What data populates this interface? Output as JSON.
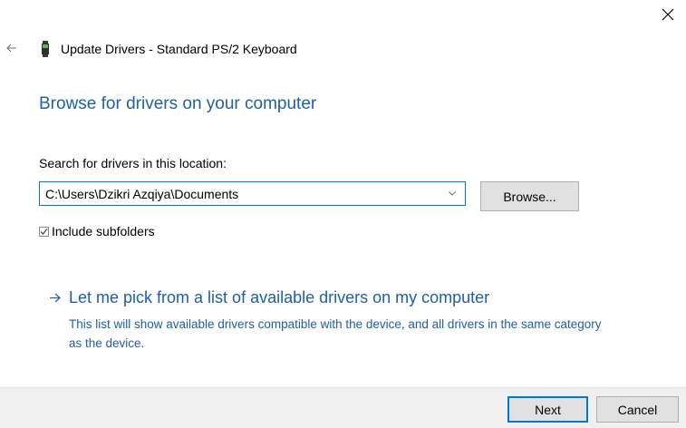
{
  "window": {
    "title": "Update Drivers - Standard PS/2 Keyboard",
    "title_icon": "keyboard-device-icon",
    "close_icon": "close-icon",
    "back_icon": "back-arrow-icon"
  },
  "main": {
    "heading": "Browse for drivers on your computer",
    "search_label": "Search for drivers in this location:",
    "path_value": "C:\\Users\\Dzikri Azqiya\\Documents",
    "browse_label": "Browse...",
    "include_subfolders_label": "Include subfolders",
    "include_subfolders_checked": true,
    "pick_link_text": "Let me pick from a list of available drivers on my computer",
    "pick_description": "This list will show available drivers compatible with the device, and all drivers in the same category as the device."
  },
  "footer": {
    "next_label": "Next",
    "cancel_label": "Cancel"
  },
  "colors": {
    "accent": "#0078d7",
    "link": "#1f5faa",
    "button_face": "#e1e1e1",
    "footer_bg": "#f0f0f0"
  }
}
